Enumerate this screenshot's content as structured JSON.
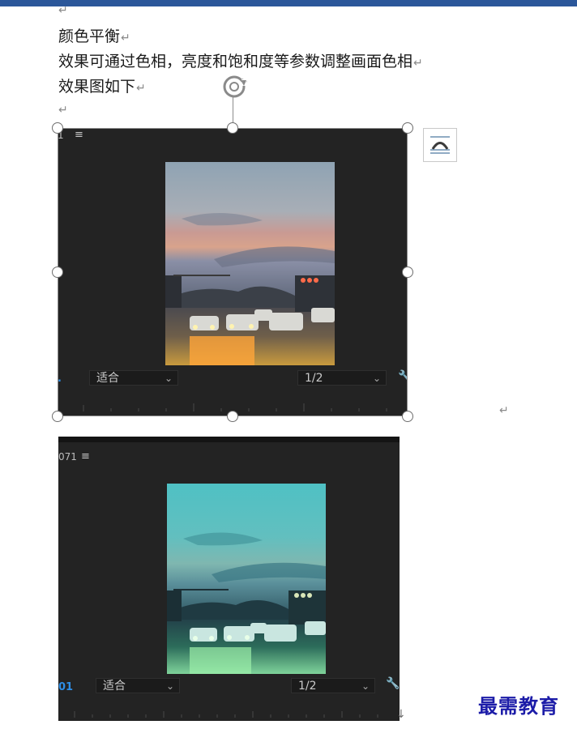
{
  "colors": {
    "top_bar": "#2b579a",
    "panel_bg": "#232323",
    "timecode": "#2e8ee6",
    "watermark": "#1c1ca8"
  },
  "document": {
    "paragraph_mark": "↵",
    "lines": [
      "颜色平衡",
      "效果可通过色相，亮度和饱和度等参数调整画面色相",
      "效果图如下"
    ]
  },
  "panel1": {
    "frame_number": "1",
    "menu_icon": "≡",
    "fit_label": "适合",
    "resolution": "1/2",
    "wrench_icon": "wrench-icon"
  },
  "panel2": {
    "frame_number": "071",
    "menu_icon": "≡",
    "timecode": "01",
    "fit_label": "适合",
    "resolution": "1/2",
    "wrench_icon": "wrench-icon"
  },
  "icons": {
    "rotate": "rotate-handle-icon",
    "layout_options": "layout-options-icon",
    "chevron": "⌄"
  },
  "watermark": "最需教育"
}
